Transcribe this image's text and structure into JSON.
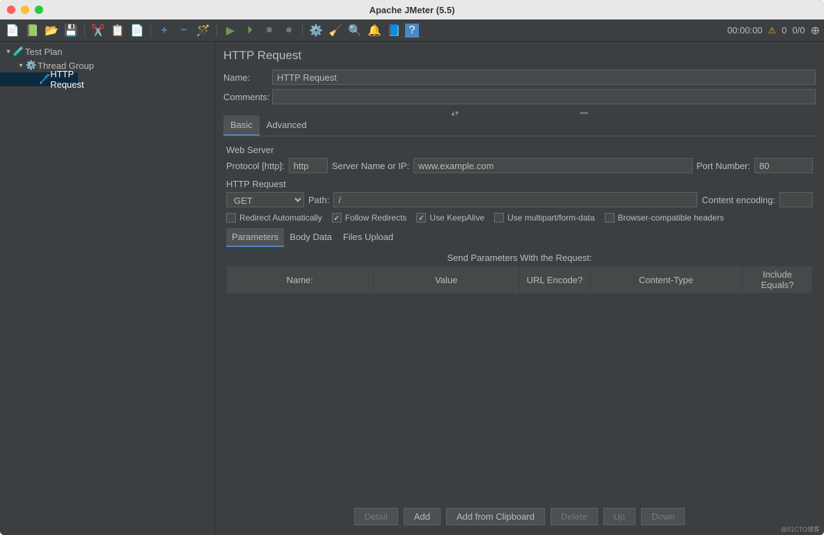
{
  "window": {
    "title": "Apache JMeter (5.5)"
  },
  "toolbar": {
    "timer": "00:00:00",
    "count1": "0",
    "count2": "0/0"
  },
  "tree": {
    "root": {
      "label": "Test Plan"
    },
    "group": {
      "label": "Thread Group"
    },
    "sampler": {
      "label": "HTTP Request"
    }
  },
  "panel": {
    "title": "HTTP Request",
    "name_label": "Name:",
    "name_value": "HTTP Request",
    "comments_label": "Comments:",
    "comments_value": ""
  },
  "tabs": {
    "basic": "Basic",
    "advanced": "Advanced"
  },
  "webserver": {
    "section": "Web Server",
    "protocol_label": "Protocol [http]:",
    "protocol_value": "http",
    "server_label": "Server Name or IP:",
    "server_value": "www.example.com",
    "port_label": "Port Number:",
    "port_value": "80"
  },
  "httpreq": {
    "section": "HTTP Request",
    "method": "GET",
    "path_label": "Path:",
    "path_value": "/",
    "encoding_label": "Content encoding:",
    "encoding_value": ""
  },
  "checks": {
    "redirect_auto": "Redirect Automatically",
    "follow_redirects": "Follow Redirects",
    "keepalive": "Use KeepAlive",
    "multipart": "Use multipart/form-data",
    "browser_compat": "Browser-compatible headers"
  },
  "subtabs": {
    "parameters": "Parameters",
    "body": "Body Data",
    "files": "Files Upload"
  },
  "table": {
    "title": "Send Parameters With the Request:",
    "cols": {
      "name": "Name:",
      "value": "Value",
      "encode": "URL Encode?",
      "ctype": "Content-Type",
      "equals": "Include Equals?"
    }
  },
  "buttons": {
    "detail": "Detail",
    "add": "Add",
    "clipboard": "Add from Clipboard",
    "delete": "Delete",
    "up": "Up",
    "down": "Down"
  }
}
